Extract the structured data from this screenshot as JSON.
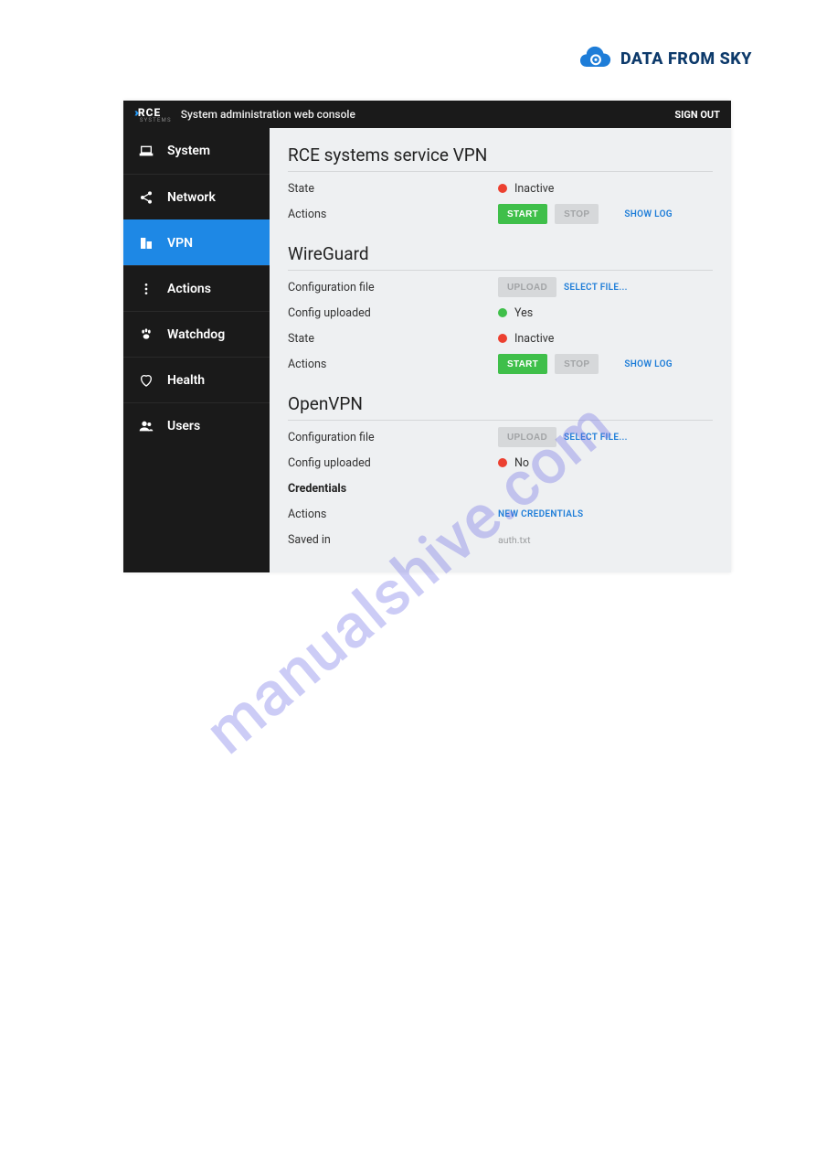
{
  "brand": {
    "text": "DATA FROM SKY"
  },
  "topbar": {
    "logo_main": "RCE",
    "logo_sub": "SYSTEMS",
    "title": "System administration web console",
    "signout": "SIGN OUT"
  },
  "sidebar": {
    "items": [
      {
        "label": "System"
      },
      {
        "label": "Network"
      },
      {
        "label": "VPN"
      },
      {
        "label": "Actions"
      },
      {
        "label": "Watchdog"
      },
      {
        "label": "Health"
      },
      {
        "label": "Users"
      }
    ]
  },
  "content": {
    "rce": {
      "title": "RCE systems service VPN",
      "state_label": "State",
      "state_value": "Inactive",
      "actions_label": "Actions",
      "start": "START",
      "stop": "STOP",
      "showlog": "SHOW LOG"
    },
    "wg": {
      "title": "WireGuard",
      "config_label": "Configuration file",
      "upload": "UPLOAD",
      "select": "SELECT FILE...",
      "uploaded_label": "Config uploaded",
      "uploaded_value": "Yes",
      "state_label": "State",
      "state_value": "Inactive",
      "actions_label": "Actions",
      "start": "START",
      "stop": "STOP",
      "showlog": "SHOW LOG"
    },
    "ovpn": {
      "title": "OpenVPN",
      "config_label": "Configuration file",
      "upload": "UPLOAD",
      "select": "SELECT FILE...",
      "uploaded_label": "Config uploaded",
      "uploaded_value": "No",
      "credentials_label": "Credentials",
      "actions_label": "Actions",
      "newcred": "NEW CREDENTIALS",
      "savedin_label": "Saved in",
      "savedin_value": "auth.txt"
    }
  },
  "watermark": "manualshive.com"
}
